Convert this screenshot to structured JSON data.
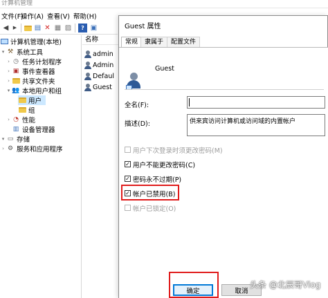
{
  "main_window": {
    "title": "计算机管理",
    "menu": [
      "文件(F)",
      "操作(A)",
      "查看(V)",
      "帮助(H)"
    ],
    "toolbar_icons": [
      "back-arrow-icon",
      "forward-arrow-icon",
      "folder-up-icon",
      "properties-pane-icon",
      "delete-x-icon",
      "properties-icon",
      "export-list-icon",
      "help-icon",
      "show-hide-pane-icon"
    ]
  },
  "tree": {
    "items": [
      {
        "label": "计算机管理(本地)",
        "level": 0,
        "arrow": "",
        "icon": "computer-management-icon"
      },
      {
        "label": "系统工具",
        "level": 1,
        "arrow": "▾",
        "icon": "tools-icon"
      },
      {
        "label": "任务计划程序",
        "level": 2,
        "arrow": "›",
        "icon": "clock-icon"
      },
      {
        "label": "事件查看器",
        "level": 2,
        "arrow": "›",
        "icon": "event-viewer-icon"
      },
      {
        "label": "共享文件夹",
        "level": 2,
        "arrow": "›",
        "icon": "shared-folder-icon"
      },
      {
        "label": "本地用户和组",
        "level": 2,
        "arrow": "▾",
        "icon": "users-icon"
      },
      {
        "label": "用户",
        "level": 3,
        "arrow": "",
        "icon": "folder-icon",
        "selected": true
      },
      {
        "label": "组",
        "level": 3,
        "arrow": "",
        "icon": "folder-icon"
      },
      {
        "label": "性能",
        "level": 2,
        "arrow": "›",
        "icon": "performance-icon"
      },
      {
        "label": "设备管理器",
        "level": 2,
        "arrow": "",
        "icon": "device-manager-icon"
      },
      {
        "label": "存储",
        "level": 1,
        "arrow": "▾",
        "icon": "storage-icon"
      },
      {
        "label": "服务和应用程序",
        "level": 1,
        "arrow": "›",
        "icon": "services-icon"
      }
    ]
  },
  "list": {
    "header": "名称",
    "items": [
      "admin",
      "Admin",
      "Defaul",
      "Guest"
    ]
  },
  "dialog": {
    "title": "Guest 属性",
    "tabs": [
      "常规",
      "隶属于",
      "配置文件"
    ],
    "username": "Guest",
    "fullname_label": "全名(F):",
    "fullname_value": "",
    "description_label": "描述(D):",
    "description_value": "供来宾访问计算机或访问域的内置帐户",
    "checkboxes": [
      {
        "label": "用户下次登录时须更改密码(M)",
        "checked": false,
        "disabled": true
      },
      {
        "label": "用户不能更改密码(C)",
        "checked": true,
        "disabled": false
      },
      {
        "label": "密码永不过期(P)",
        "checked": true,
        "disabled": false
      },
      {
        "label": "帐户已禁用(B)",
        "checked": true,
        "disabled": false
      },
      {
        "label": "帐户已锁定(O)",
        "checked": false,
        "disabled": true
      }
    ],
    "ok_label": "确定",
    "cancel_label": "取消"
  },
  "watermark": "头条 @北辰哥Vlog",
  "colors": {
    "highlight_red": "#e01b1b",
    "selection_blue": "#cce8ff",
    "ok_border": "#0078d7"
  }
}
